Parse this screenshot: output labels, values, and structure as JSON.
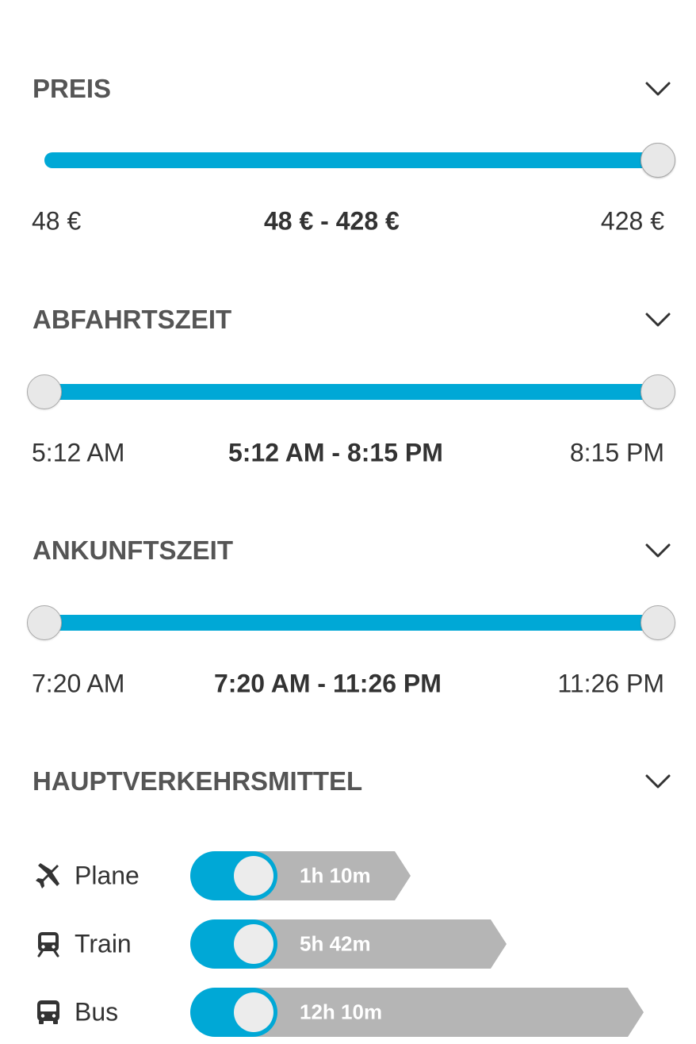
{
  "filters": {
    "price": {
      "title": "PREIS",
      "min_label": "48 €",
      "max_label": "428 €",
      "selected_label": "48 € - 428 €",
      "selected_low_fraction": 1.0,
      "selected_high_fraction": 1.0
    },
    "departure": {
      "title": "ABFAHRTSZEIT",
      "min_label": "5:12 AM",
      "max_label": "8:15 PM",
      "selected_label": "5:12 AM - 8:15 PM",
      "selected_low_fraction": 0.0,
      "selected_high_fraction": 1.0
    },
    "arrival": {
      "title": "ANKUNFTSZEIT",
      "min_label": "7:20 AM",
      "max_label": "11:26 PM",
      "selected_label": "7:20 AM - 11:26 PM",
      "selected_low_fraction": 0.0,
      "selected_high_fraction": 1.0
    },
    "transport": {
      "title": "HAUPTVERKEHRSMITTEL",
      "modes": [
        {
          "label": "Plane",
          "icon": "plane-icon",
          "enabled": true,
          "duration": "1h 10m",
          "duration_minutes": 70
        },
        {
          "label": "Train",
          "icon": "train-icon",
          "enabled": true,
          "duration": "5h 42m",
          "duration_minutes": 342
        },
        {
          "label": "Bus",
          "icon": "bus-icon",
          "enabled": true,
          "duration": "12h 10m",
          "duration_minutes": 730
        }
      ]
    }
  },
  "colors": {
    "accent": "#00a8d6",
    "duration_bar": "#b5b5b5",
    "knob": "#e8e8e8",
    "title": "#555555",
    "text": "#333333"
  }
}
